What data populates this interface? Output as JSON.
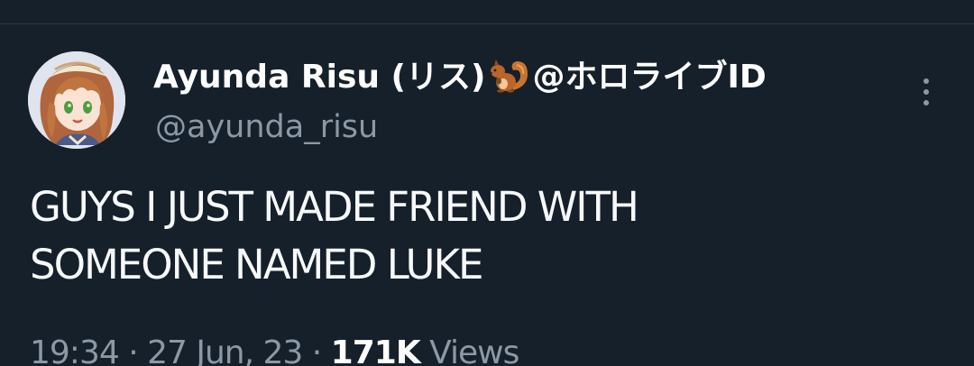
{
  "tweet": {
    "author": {
      "display_name_prefix": "Ayunda Risu (リス)",
      "display_name_suffix": "@ホロライブID",
      "name_emoji": "squirrel-emoji",
      "handle": "@ayunda_risu",
      "avatar": "avatar-image"
    },
    "text_lines": [
      "GUYS I JUST MADE FRIEND WITH",
      "SOMEONE NAMED LUKE"
    ],
    "time": "19:34",
    "separator": "·",
    "date": "27 Jun, 23",
    "views_count": "171K",
    "views_label": "Views"
  },
  "icons": {
    "more": "more-vertical-icon"
  },
  "colors": {
    "background": "#15202b",
    "text_primary": "#ffffff",
    "text_secondary": "#8b98a5",
    "divider": "#2b3540"
  }
}
